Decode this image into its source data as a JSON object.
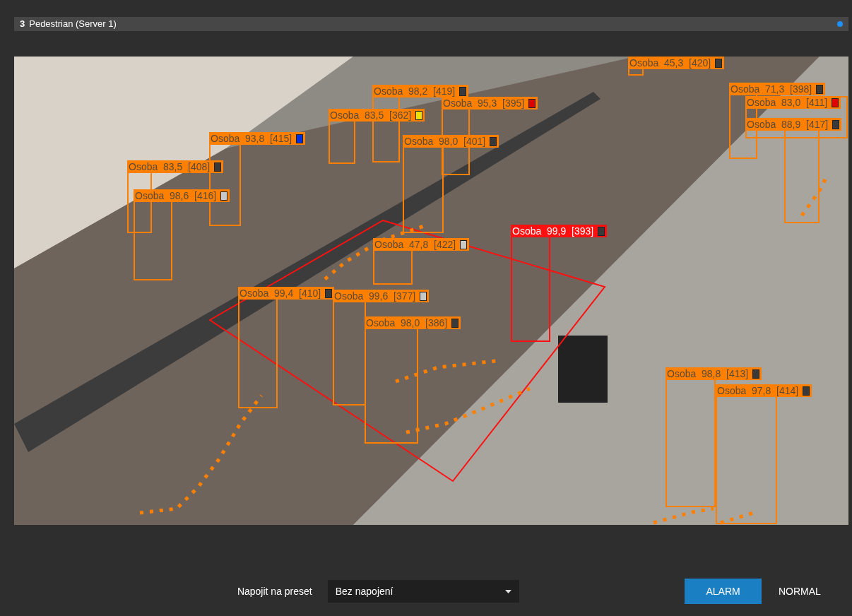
{
  "title_bar": {
    "number": "3",
    "title": "Pedestrian (Server 1)"
  },
  "detections": [
    {
      "label": "Osoba  45,3  [420]",
      "alarm": false,
      "color": "#3a3a3a"
    },
    {
      "label": "Osoba  98,2  [419]",
      "alarm": false,
      "color": "#3a3a3a"
    },
    {
      "label": "Osoba  71,3  [398]",
      "alarm": false,
      "color": "#3a3a3a"
    },
    {
      "label": "Osoba  95,3  [395]",
      "alarm": false,
      "color": "#e00000"
    },
    {
      "label": "Osoba  83,0  [411]",
      "alarm": false,
      "color": "#e00000"
    },
    {
      "label": "Osoba  83,5  [362]",
      "alarm": false,
      "color": "#f0e000"
    },
    {
      "label": "Osoba  88,9  [417]",
      "alarm": false,
      "color": "#3a3a3a"
    },
    {
      "label": "Osoba  93,8  [415]",
      "alarm": false,
      "color": "#0030e0"
    },
    {
      "label": "Osoba  98,0  [401]",
      "alarm": false,
      "color": "#3a3a3a"
    },
    {
      "label": "Osoba  83,5  [408]",
      "alarm": false,
      "color": "#3a3a3a"
    },
    {
      "label": "Osoba  98,6  [416]",
      "alarm": false,
      "color": "#c8c8c8"
    },
    {
      "label": "Osoba  99,9  [393]",
      "alarm": true,
      "color": "#3a3a3a"
    },
    {
      "label": "Osoba  47,8  [422]",
      "alarm": false,
      "color": "#c8c8c8"
    },
    {
      "label": "Osoba  99,4  [410]",
      "alarm": false,
      "color": "#3a3a3a"
    },
    {
      "label": "Osoba  99,6  [377]",
      "alarm": false,
      "color": "#c8c8c8"
    },
    {
      "label": "Osoba  98,0  [386]",
      "alarm": false,
      "color": "#3a3a3a"
    },
    {
      "label": "Osoba  98,8  [413]",
      "alarm": false,
      "color": "#3a3a3a"
    },
    {
      "label": "Osoba  97,8  [414]",
      "alarm": false,
      "color": "#3a3a3a"
    }
  ],
  "footer": {
    "preset_label": "Napojit na preset",
    "preset_select": {
      "value": "Bez napojení"
    },
    "buttons": [
      {
        "label": "ALARM",
        "selected": true
      },
      {
        "label": "NORMAL",
        "selected": false
      }
    ]
  }
}
